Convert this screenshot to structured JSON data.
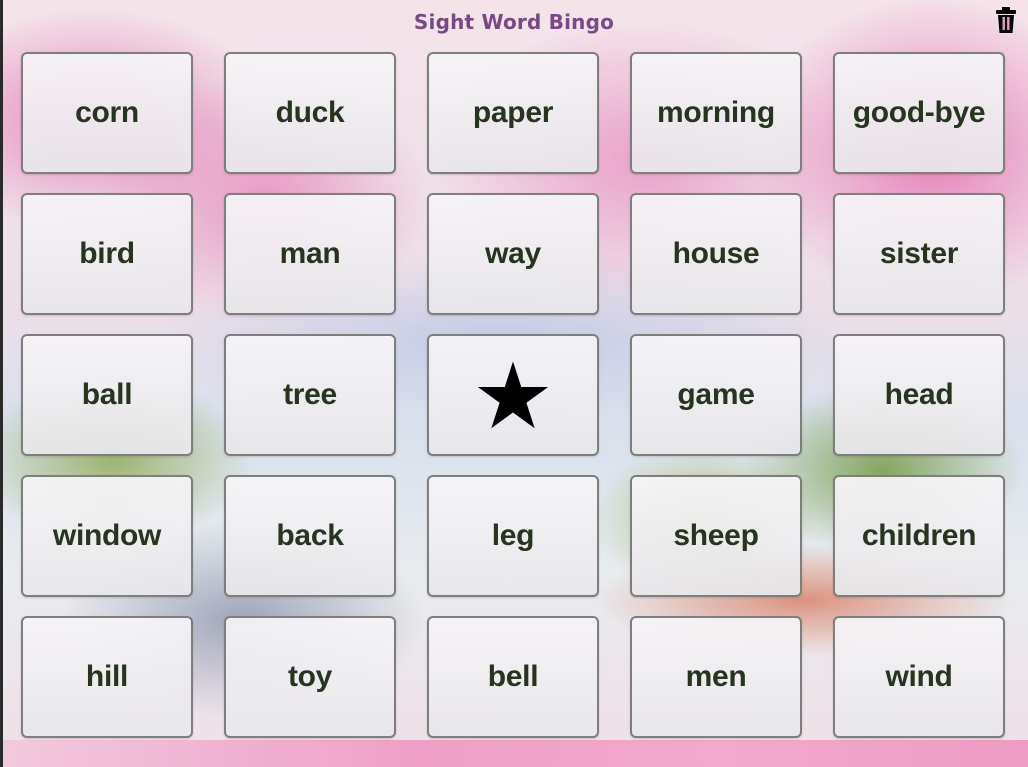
{
  "app": {
    "title": "Sight Word Bingo",
    "title_color": "#7a4787",
    "trash_icon": "trash-icon"
  },
  "board": {
    "free_space_icon": "star-icon",
    "free_space_index": 12,
    "rows": [
      [
        "corn",
        "duck",
        "paper",
        "morning",
        "good-bye"
      ],
      [
        "bird",
        "man",
        "way",
        "house",
        "sister"
      ],
      [
        "ball",
        "tree",
        "",
        "game",
        "head"
      ],
      [
        "window",
        "back",
        "leg",
        "sheep",
        "children"
      ],
      [
        "hill",
        "toy",
        "bell",
        "men",
        "wind"
      ]
    ],
    "cells": [
      {
        "label": "corn"
      },
      {
        "label": "duck"
      },
      {
        "label": "paper"
      },
      {
        "label": "morning"
      },
      {
        "label": "good-bye"
      },
      {
        "label": "bird"
      },
      {
        "label": "man"
      },
      {
        "label": "way"
      },
      {
        "label": "house"
      },
      {
        "label": "sister"
      },
      {
        "label": "ball"
      },
      {
        "label": "tree"
      },
      {
        "label": ""
      },
      {
        "label": "game"
      },
      {
        "label": "head"
      },
      {
        "label": "window"
      },
      {
        "label": "back"
      },
      {
        "label": "leg"
      },
      {
        "label": "sheep"
      },
      {
        "label": "children"
      },
      {
        "label": "hill"
      },
      {
        "label": "toy"
      },
      {
        "label": "bell"
      },
      {
        "label": "men"
      },
      {
        "label": "wind"
      }
    ],
    "word_color": "#263420"
  }
}
